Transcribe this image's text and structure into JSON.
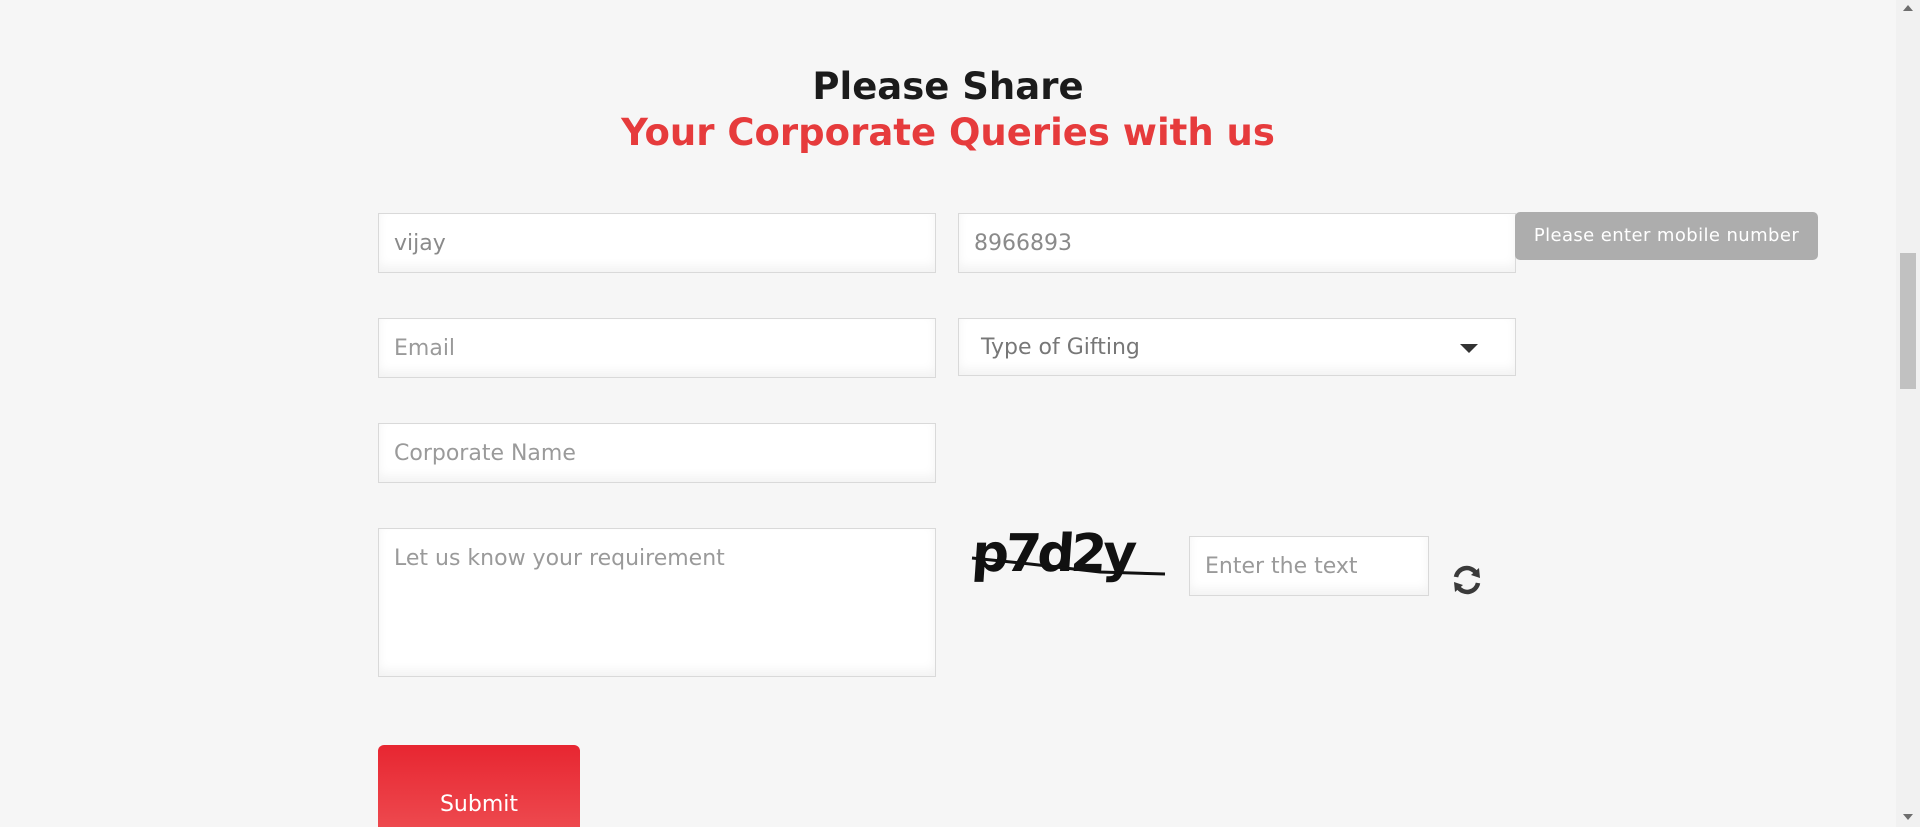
{
  "heading": {
    "line1": "Please Share",
    "line2": "Your Corporate Queries with us"
  },
  "form": {
    "name": {
      "value": "vijay"
    },
    "mobile": {
      "value": "8966893"
    },
    "mobile_error": "Please enter mobile number",
    "email": {
      "placeholder": "Email"
    },
    "gifting": {
      "selected": "Type of Gifting"
    },
    "corporate_name": {
      "placeholder": "Corporate Name"
    },
    "requirement": {
      "placeholder": "Let us know your requirement"
    },
    "captcha": {
      "image_text": "p7d2y",
      "input_placeholder": "Enter the text"
    },
    "submit_label": "Submit"
  },
  "colors": {
    "accent": "#e63b3c",
    "submit_top": "#e72631",
    "submit_bottom": "#ee4c51",
    "tooltip_bg": "#adadad",
    "page_bg": "#f6f6f6"
  },
  "icons": {
    "captcha_refresh": "refresh-icon",
    "select_caret": "chevron-down-icon"
  }
}
